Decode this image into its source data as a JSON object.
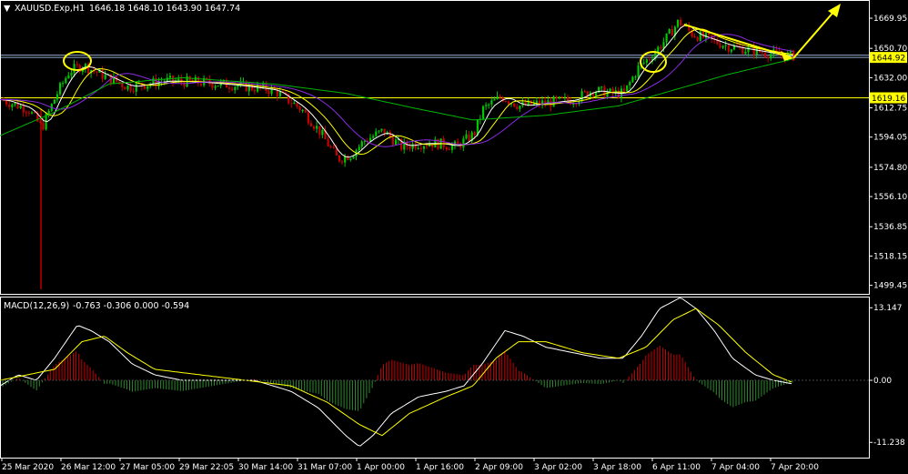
{
  "header": {
    "symbol": "XAUUSD.Exp,H1",
    "ohlc": "1646.18 1648.10 1643.90 1647.74"
  },
  "macd_header": {
    "label": "MACD(12,26,9)",
    "values": "-0.763 -0.306 0.000 -0.594"
  },
  "price_axis": {
    "ticks": [
      "1669.95",
      "1650.70",
      "1632.00",
      "1612.75",
      "1594.05",
      "1574.80",
      "1556.10",
      "1536.85",
      "1518.15",
      "1499.45"
    ],
    "tag_current": "1644.92",
    "tag_level": "1619.16"
  },
  "macd_axis": {
    "ticks": [
      "13.147",
      "0.00",
      "-11.238"
    ]
  },
  "time_axis": {
    "ticks": [
      "25 Mar 2020",
      "26 Mar 12:00",
      "27 Mar 05:00",
      "29 Mar 22:05",
      "30 Mar 14:00",
      "31 Mar 07:00",
      "1 Apr 00:00",
      "1 Apr 16:00",
      "2 Apr 09:00",
      "3 Apr 02:00",
      "3 Apr 18:00",
      "6 Apr 11:00",
      "7 Apr 04:00",
      "7 Apr 20:00"
    ]
  },
  "colors": {
    "background": "#000000",
    "bull": "#00c800",
    "bear": "#c80000",
    "ma_fast": "#ffffff",
    "ma_mid": "#ffff00",
    "ma_slow": "#8a2be2",
    "ma_long": "#00b400",
    "annotation": "#ffff00",
    "level_line": "#ffff00",
    "grid_line": "#8fa8c8",
    "macd_line": "#ffffff",
    "signal_line": "#ffff00",
    "hist_pos": "#c80000",
    "hist_neg": "#2e8b2e"
  },
  "chart_data": {
    "type": "candlestick",
    "timeframe": "H1",
    "price_range": [
      1494,
      1681
    ],
    "macd_range": [
      -14,
      15
    ],
    "horizontal_levels": [
      1644.92,
      1646.4,
      1619.16
    ],
    "price_waypoints": [
      [
        0,
        1618
      ],
      [
        30,
        1612
      ],
      [
        45,
        1600
      ],
      [
        60,
        1620
      ],
      [
        75,
        1636
      ],
      [
        90,
        1640
      ],
      [
        110,
        1634
      ],
      [
        140,
        1626
      ],
      [
        180,
        1630
      ],
      [
        220,
        1629
      ],
      [
        260,
        1627
      ],
      [
        300,
        1624
      ],
      [
        330,
        1612
      ],
      [
        350,
        1598
      ],
      [
        370,
        1580
      ],
      [
        385,
        1583
      ],
      [
        400,
        1592
      ],
      [
        420,
        1598
      ],
      [
        440,
        1588
      ],
      [
        460,
        1590
      ],
      [
        480,
        1590
      ],
      [
        500,
        1588
      ],
      [
        520,
        1596
      ],
      [
        530,
        1612
      ],
      [
        550,
        1620
      ],
      [
        570,
        1614
      ],
      [
        600,
        1616
      ],
      [
        630,
        1618
      ],
      [
        650,
        1624
      ],
      [
        670,
        1622
      ],
      [
        685,
        1622
      ],
      [
        700,
        1638
      ],
      [
        715,
        1646
      ],
      [
        730,
        1656
      ],
      [
        745,
        1668
      ],
      [
        760,
        1660
      ],
      [
        780,
        1656
      ],
      [
        800,
        1652
      ],
      [
        820,
        1650
      ],
      [
        840,
        1648
      ],
      [
        858,
        1646
      ],
      [
        872,
        1646
      ]
    ],
    "macd_waypoints": [
      [
        0,
        -1
      ],
      [
        20,
        1
      ],
      [
        40,
        0
      ],
      [
        60,
        4
      ],
      [
        85,
        10
      ],
      [
        100,
        9
      ],
      [
        120,
        7
      ],
      [
        145,
        3
      ],
      [
        170,
        1
      ],
      [
        200,
        0
      ],
      [
        240,
        0
      ],
      [
        280,
        0
      ],
      [
        320,
        -2
      ],
      [
        350,
        -5
      ],
      [
        380,
        -10
      ],
      [
        395,
        -12
      ],
      [
        410,
        -10
      ],
      [
        430,
        -6
      ],
      [
        460,
        -3
      ],
      [
        490,
        -2
      ],
      [
        510,
        -1
      ],
      [
        530,
        3
      ],
      [
        555,
        9
      ],
      [
        575,
        8
      ],
      [
        600,
        6
      ],
      [
        630,
        5
      ],
      [
        660,
        4
      ],
      [
        685,
        4
      ],
      [
        705,
        8
      ],
      [
        725,
        13
      ],
      [
        748,
        15
      ],
      [
        765,
        13
      ],
      [
        785,
        9
      ],
      [
        805,
        4
      ],
      [
        830,
        1
      ],
      [
        850,
        0
      ],
      [
        870,
        -0.6
      ]
    ],
    "signal_waypoints": [
      [
        0,
        0
      ],
      [
        30,
        1
      ],
      [
        60,
        2
      ],
      [
        90,
        7
      ],
      [
        115,
        8
      ],
      [
        140,
        5
      ],
      [
        170,
        2
      ],
      [
        220,
        1
      ],
      [
        270,
        0
      ],
      [
        320,
        -1
      ],
      [
        360,
        -4
      ],
      [
        395,
        -8
      ],
      [
        420,
        -10
      ],
      [
        450,
        -6
      ],
      [
        490,
        -3
      ],
      [
        520,
        -1
      ],
      [
        545,
        4
      ],
      [
        570,
        7
      ],
      [
        600,
        7
      ],
      [
        640,
        5
      ],
      [
        680,
        4
      ],
      [
        710,
        6
      ],
      [
        740,
        11
      ],
      [
        765,
        13
      ],
      [
        790,
        10
      ],
      [
        820,
        5
      ],
      [
        850,
        1
      ],
      [
        870,
        -0.3
      ]
    ]
  }
}
